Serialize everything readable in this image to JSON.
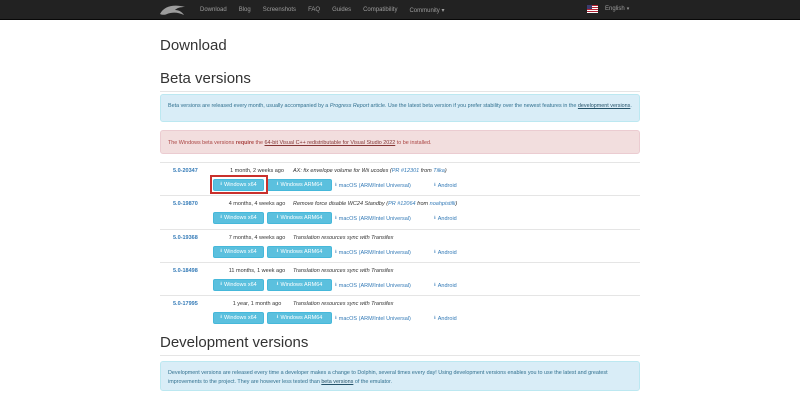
{
  "nav": {
    "items": [
      "Download",
      "Blog",
      "Screenshots",
      "FAQ",
      "Guides",
      "Compatibility",
      "Community"
    ],
    "community_caret": "▾",
    "language": "English",
    "language_caret": "▾"
  },
  "page": {
    "title": "Download",
    "beta_heading": "Beta versions",
    "dev_heading": "Development versions"
  },
  "beta_info": {
    "text_1": "Beta versions are released every month, usually accompanied by a ",
    "progress_report": "Progress Report",
    "text_2": " article. Use the latest beta version if you prefer stability over the newest features in the ",
    "dev_link": "development versions",
    "text_3": "."
  },
  "beta_warning": {
    "text_1": "The Windows beta versions ",
    "require": "require",
    "text_2": " the ",
    "redist_link": "64-bit Visual C++ redistributable for Visual Studio 2022",
    "text_3": " to be installed."
  },
  "download_labels": {
    "win_x64": "Windows x64",
    "win_arm": "Windows ARM64",
    "macos": "macOS (ARM/Intel Universal)",
    "android": "Android"
  },
  "beta_rows": [
    {
      "version": "5.0-20347",
      "date": "1 month, 2 weeks ago",
      "desc_main": "AX: fix envelope volume for Wii ucodes (",
      "pr": "PR #12301",
      "desc_from": " from ",
      "author": "Tilka",
      "desc_end": ")"
    },
    {
      "version": "5.0-19870",
      "date": "4 months, 4 weeks ago",
      "desc_main": "Remove force disable WC24 Standby (",
      "pr": "PR #12064",
      "desc_from": " from ",
      "author": "noahpistilli",
      "desc_end": ")"
    },
    {
      "version": "5.0-19368",
      "date": "7 months, 4 weeks ago",
      "desc_main": "Translation resources sync with Transifex",
      "pr": "",
      "desc_from": "",
      "author": "",
      "desc_end": ""
    },
    {
      "version": "5.0-18498",
      "date": "11 months, 1 week ago",
      "desc_main": "Translation resources sync with Transifex",
      "pr": "",
      "desc_from": "",
      "author": "",
      "desc_end": ""
    },
    {
      "version": "5.0-17995",
      "date": "1 year, 1 month ago",
      "desc_main": "Translation resources sync with Transifex",
      "pr": "",
      "desc_from": "",
      "author": "",
      "desc_end": ""
    }
  ],
  "dev_info": {
    "text_1": "Development versions are released every time a developer makes a change to Dolphin, several times every day! Using development versions enables you to use the latest and greatest improvements to the project. They are however less tested than ",
    "beta_link": "beta versions",
    "text_2": " of the emulator."
  },
  "icons": {
    "download": "⭳",
    "logo": "dolphin-logo"
  },
  "colors": {
    "navbar": "#222222",
    "info_bg": "#d9edf7",
    "danger_bg": "#f2dede",
    "button": "#5bc0de",
    "link": "#337ab7",
    "highlight": "#c9302c"
  }
}
